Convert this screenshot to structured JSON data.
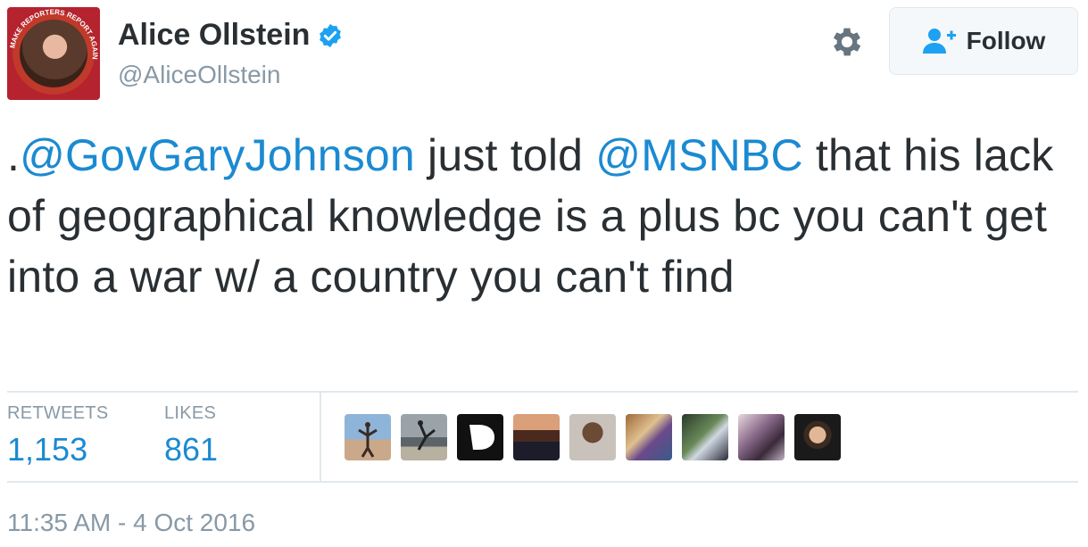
{
  "author": {
    "name": "Alice Ollstein",
    "handle": "@AliceOllstein",
    "verified": true,
    "avatar_badge_text": "MAKE REPORTERS REPORT AGAIN"
  },
  "header": {
    "settings_icon": "gear-icon",
    "follow_label": "Follow",
    "follow_icon": "add-user-icon"
  },
  "tweet": {
    "segments": [
      {
        "text": ".",
        "type": "text"
      },
      {
        "text": "@GovGaryJohnson",
        "type": "mention"
      },
      {
        "text": " just told ",
        "type": "text"
      },
      {
        "text": "@MSNBC",
        "type": "mention"
      },
      {
        "text": " that his lack of geographical knowledge is a plus bc you can't get into a war w/ a country you can't find",
        "type": "text"
      }
    ]
  },
  "stats": {
    "retweets_label": "RETWEETS",
    "retweets_value": "1,153",
    "likes_label": "LIKES",
    "likes_value": "861"
  },
  "likers_count": 9,
  "timestamp": "11:35 AM - 4 Oct 2016",
  "colors": {
    "link": "#1b8ad1",
    "muted": "#8899a6",
    "text": "#292f33",
    "verified": "#1da1f2",
    "border": "#e1e8ed"
  }
}
